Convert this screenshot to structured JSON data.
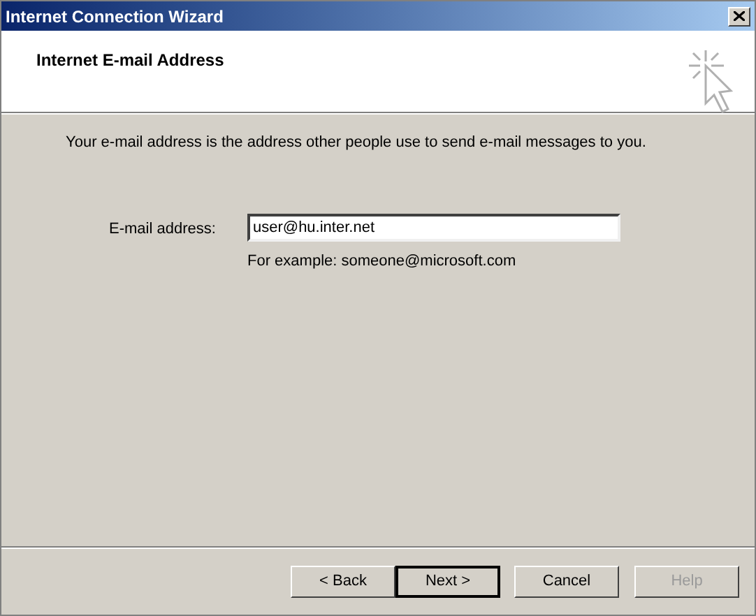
{
  "window": {
    "title": "Internet Connection Wizard"
  },
  "header": {
    "title": "Internet E-mail Address"
  },
  "intro": "Your e-mail address is the address other people use to send e-mail messages to you.",
  "email": {
    "label": "E-mail address:",
    "value": "user@hu.inter.net",
    "hint": "For example: someone@microsoft.com"
  },
  "buttons": [
    {
      "label": "< Back",
      "default": false,
      "disabled": false
    },
    {
      "label": "Next >",
      "default": true,
      "disabled": false
    },
    {
      "label": "Cancel",
      "default": false,
      "disabled": false
    },
    {
      "label": "Help",
      "default": false,
      "disabled": true
    }
  ]
}
